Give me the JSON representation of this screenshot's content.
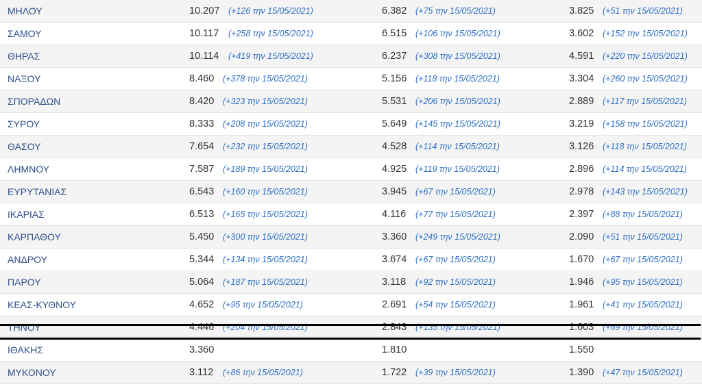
{
  "rows": [
    {
      "name": "ΜΗΛΟΥ",
      "v1": "10.207",
      "d1": "(+126 την 15/05/2021)",
      "v2": "6.382",
      "d2": "(+75 την 15/05/2021)",
      "v3": "3.825",
      "d3": "(+51 την 15/05/2021)"
    },
    {
      "name": "ΣΑΜΟΥ",
      "v1": "10.117",
      "d1": "(+258 την 15/05/2021)",
      "v2": "6.515",
      "d2": "(+106 την 15/05/2021)",
      "v3": "3.602",
      "d3": "(+152 την 15/05/2021)"
    },
    {
      "name": "ΘΗΡΑΣ",
      "v1": "10.114",
      "d1": "(+419 την 15/05/2021)",
      "v2": "6.237",
      "d2": "(+308 την 15/05/2021)",
      "v3": "4.591",
      "d3": "(+220 την 15/05/2021)"
    },
    {
      "name": "ΝΑΞΟΥ",
      "v1": "8.460",
      "d1": "(+378 την 15/05/2021)",
      "v2": "5.156",
      "d2": "(+118 την 15/05/2021)",
      "v3": "3.304",
      "d3": "(+260 την 15/05/2021)"
    },
    {
      "name": "ΣΠΟΡΑΔΩΝ",
      "v1": "8.420",
      "d1": "(+323 την 15/05/2021)",
      "v2": "5.531",
      "d2": "(+206 την 15/05/2021)",
      "v3": "2.889",
      "d3": "(+117 την 15/05/2021)"
    },
    {
      "name": "ΣΥΡΟΥ",
      "v1": "8.333",
      "d1": "(+208 την 15/05/2021)",
      "v2": "5.649",
      "d2": "(+145 την 15/05/2021)",
      "v3": "3.219",
      "d3": "(+158 την 15/05/2021)"
    },
    {
      "name": "ΘΑΣΟΥ",
      "v1": "7.654",
      "d1": "(+232 την 15/05/2021)",
      "v2": "4.528",
      "d2": "(+114 την 15/05/2021)",
      "v3": "3.126",
      "d3": "(+118 την 15/05/2021)"
    },
    {
      "name": "ΛΗΜΝΟΥ",
      "v1": "7.587",
      "d1": "(+189 την 15/05/2021)",
      "v2": "4.925",
      "d2": "(+119 την 15/05/2021)",
      "v3": "2.896",
      "d3": "(+114 την 15/05/2021)"
    },
    {
      "name": "ΕΥΡΥΤΑΝΙΑΣ",
      "v1": "6.543",
      "d1": "(+160 την 15/05/2021)",
      "v2": "3.945",
      "d2": "(+67 την 15/05/2021)",
      "v3": "2.978",
      "d3": "(+143 την 15/05/2021)"
    },
    {
      "name": "ΙΚΑΡΙΑΣ",
      "v1": "6.513",
      "d1": "(+165 την 15/05/2021)",
      "v2": "4.116",
      "d2": "(+77 την 15/05/2021)",
      "v3": "2.397",
      "d3": "(+88 την 15/05/2021)"
    },
    {
      "name": "ΚΑΡΠΑΘΟΥ",
      "v1": "5.450",
      "d1": "(+300 την 15/05/2021)",
      "v2": "3.360",
      "d2": "(+249 την 15/05/2021)",
      "v3": "2.090",
      "d3": "(+51 την 15/05/2021)"
    },
    {
      "name": "ΑΝΔΡΟΥ",
      "v1": "5.344",
      "d1": "(+134 την 15/05/2021)",
      "v2": "3.674",
      "d2": "(+67 την 15/05/2021)",
      "v3": "1.670",
      "d3": "(+67 την 15/05/2021)"
    },
    {
      "name": "ΠΑΡΟΥ",
      "v1": "5.064",
      "d1": "(+187 την 15/05/2021)",
      "v2": "3.118",
      "d2": "(+92 την 15/05/2021)",
      "v3": "1.946",
      "d3": "(+95 την 15/05/2021)"
    },
    {
      "name": "ΚΕΑΣ-ΚΥΘΝΟΥ",
      "v1": "4.652",
      "d1": "(+95 την 15/05/2021)",
      "v2": "2.691",
      "d2": "(+54 την 15/05/2021)",
      "v3": "1.961",
      "d3": "(+41 την 15/05/2021)"
    },
    {
      "name": "ΤΗΝΟΥ",
      "v1": "4.446",
      "d1": "(+204 την 15/05/2021)",
      "v2": "2.843",
      "d2": "(+135 την 15/05/2021)",
      "v3": "1.603",
      "d3": "(+69 την 15/05/2021)"
    },
    {
      "name": "ΙΘΑΚΗΣ",
      "v1": "3.360",
      "d1": "",
      "v2": "1.810",
      "d2": "",
      "v3": "1.550",
      "d3": ""
    },
    {
      "name": "ΜΥΚΟΝΟΥ",
      "v1": "3.112",
      "d1": "(+86 την 15/05/2021)",
      "v2": "1.722",
      "d2": "(+39 την 15/05/2021)",
      "v3": "1.390",
      "d3": "(+47 την 15/05/2021)"
    }
  ]
}
